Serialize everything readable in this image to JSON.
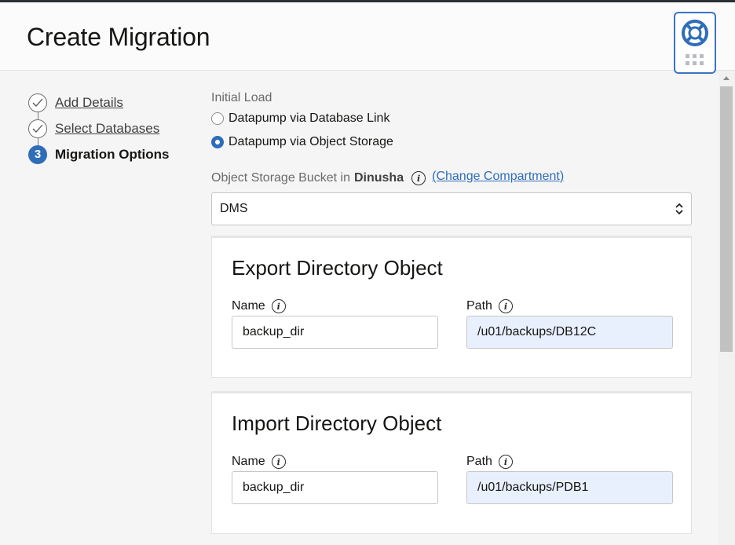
{
  "header": {
    "title": "Create Migration"
  },
  "help_widget": {
    "icon": "lifebuoy-icon",
    "accent": "#3a74c3"
  },
  "steps": [
    {
      "label": "Add Details",
      "status": "complete",
      "icon": "checkmark-icon"
    },
    {
      "label": "Select Databases",
      "status": "complete",
      "icon": "checkmark-icon"
    },
    {
      "label": "Migration Options",
      "status": "current",
      "number": "3"
    }
  ],
  "initial_load": {
    "label": "Initial Load",
    "options": [
      {
        "label": "Datapump via Database Link",
        "checked": false
      },
      {
        "label": "Datapump via Object Storage",
        "checked": true
      }
    ]
  },
  "bucket": {
    "label": "Object Storage Bucket in",
    "compartment": "Dinusha",
    "change_link": "(Change Compartment)",
    "selected": "DMS"
  },
  "export_dir": {
    "title": "Export Directory Object",
    "name_label": "Name",
    "name_value": "backup_dir",
    "path_label": "Path",
    "path_value": "/u01/backups/DB12C"
  },
  "import_dir": {
    "title": "Import Directory Object",
    "name_label": "Name",
    "name_value": "backup_dir",
    "path_label": "Path",
    "path_value": "/u01/backups/PDB1"
  },
  "colors": {
    "accent": "#2e6dba",
    "autofill": "#e8f0fe"
  }
}
